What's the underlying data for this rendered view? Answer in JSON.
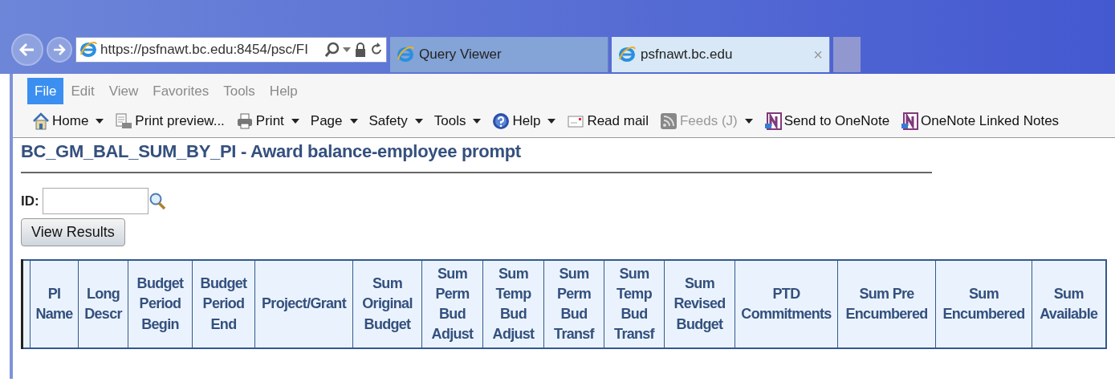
{
  "browser": {
    "address": "https://psfnawt.bc.edu:8454/psc/FI",
    "tabs": [
      {
        "label": "Query Viewer",
        "selected": false
      },
      {
        "label": "psfnawt.bc.edu",
        "selected": true,
        "close": "×"
      }
    ]
  },
  "menu": [
    {
      "label": "File",
      "selected": true
    },
    {
      "label": "Edit",
      "selected": false
    },
    {
      "label": "View",
      "selected": false
    },
    {
      "label": "Favorites",
      "selected": false
    },
    {
      "label": "Tools",
      "selected": false
    },
    {
      "label": "Help",
      "selected": false
    }
  ],
  "toolbar": [
    {
      "label": "Home",
      "kind": "home",
      "caret": true,
      "disabled": false
    },
    {
      "label": "Print preview...",
      "kind": "preview",
      "caret": false,
      "disabled": false
    },
    {
      "label": "Print",
      "kind": "printer",
      "caret": true,
      "disabled": false
    },
    {
      "label": "Page",
      "kind": "menu",
      "caret": true,
      "disabled": false
    },
    {
      "label": "Safety",
      "kind": "menu",
      "caret": true,
      "disabled": false
    },
    {
      "label": "Tools",
      "kind": "menu",
      "caret": true,
      "disabled": false
    },
    {
      "label": "Help",
      "kind": "help",
      "caret": true,
      "disabled": false
    },
    {
      "label": "Read mail",
      "kind": "mail",
      "caret": false,
      "disabled": false
    },
    {
      "label": "Feeds (J)",
      "kind": "feed",
      "caret": true,
      "disabled": true
    },
    {
      "label": "Send to OneNote",
      "kind": "onenote",
      "caret": false,
      "disabled": false
    },
    {
      "label": "OneNote Linked Notes",
      "kind": "onenote",
      "caret": false,
      "disabled": false
    }
  ],
  "page": {
    "title": "BC_GM_BAL_SUM_BY_PI - Award balance-employee prompt",
    "id_label": "ID:",
    "button": "View Results",
    "columns": [
      "PI Name",
      "Long Descr",
      "Budget Period Begin",
      "Budget Period End",
      "Project/Grant",
      "Sum Original Budget",
      "Sum Perm Bud Adjust",
      "Sum Temp Bud Adjust",
      "Sum Perm Bud Transf",
      "Sum Temp Bud Transf",
      "Sum Revised Budget",
      "PTD Commitments",
      "Sum Pre Encumbered",
      "Sum Encumbered",
      "Sum Available"
    ]
  }
}
